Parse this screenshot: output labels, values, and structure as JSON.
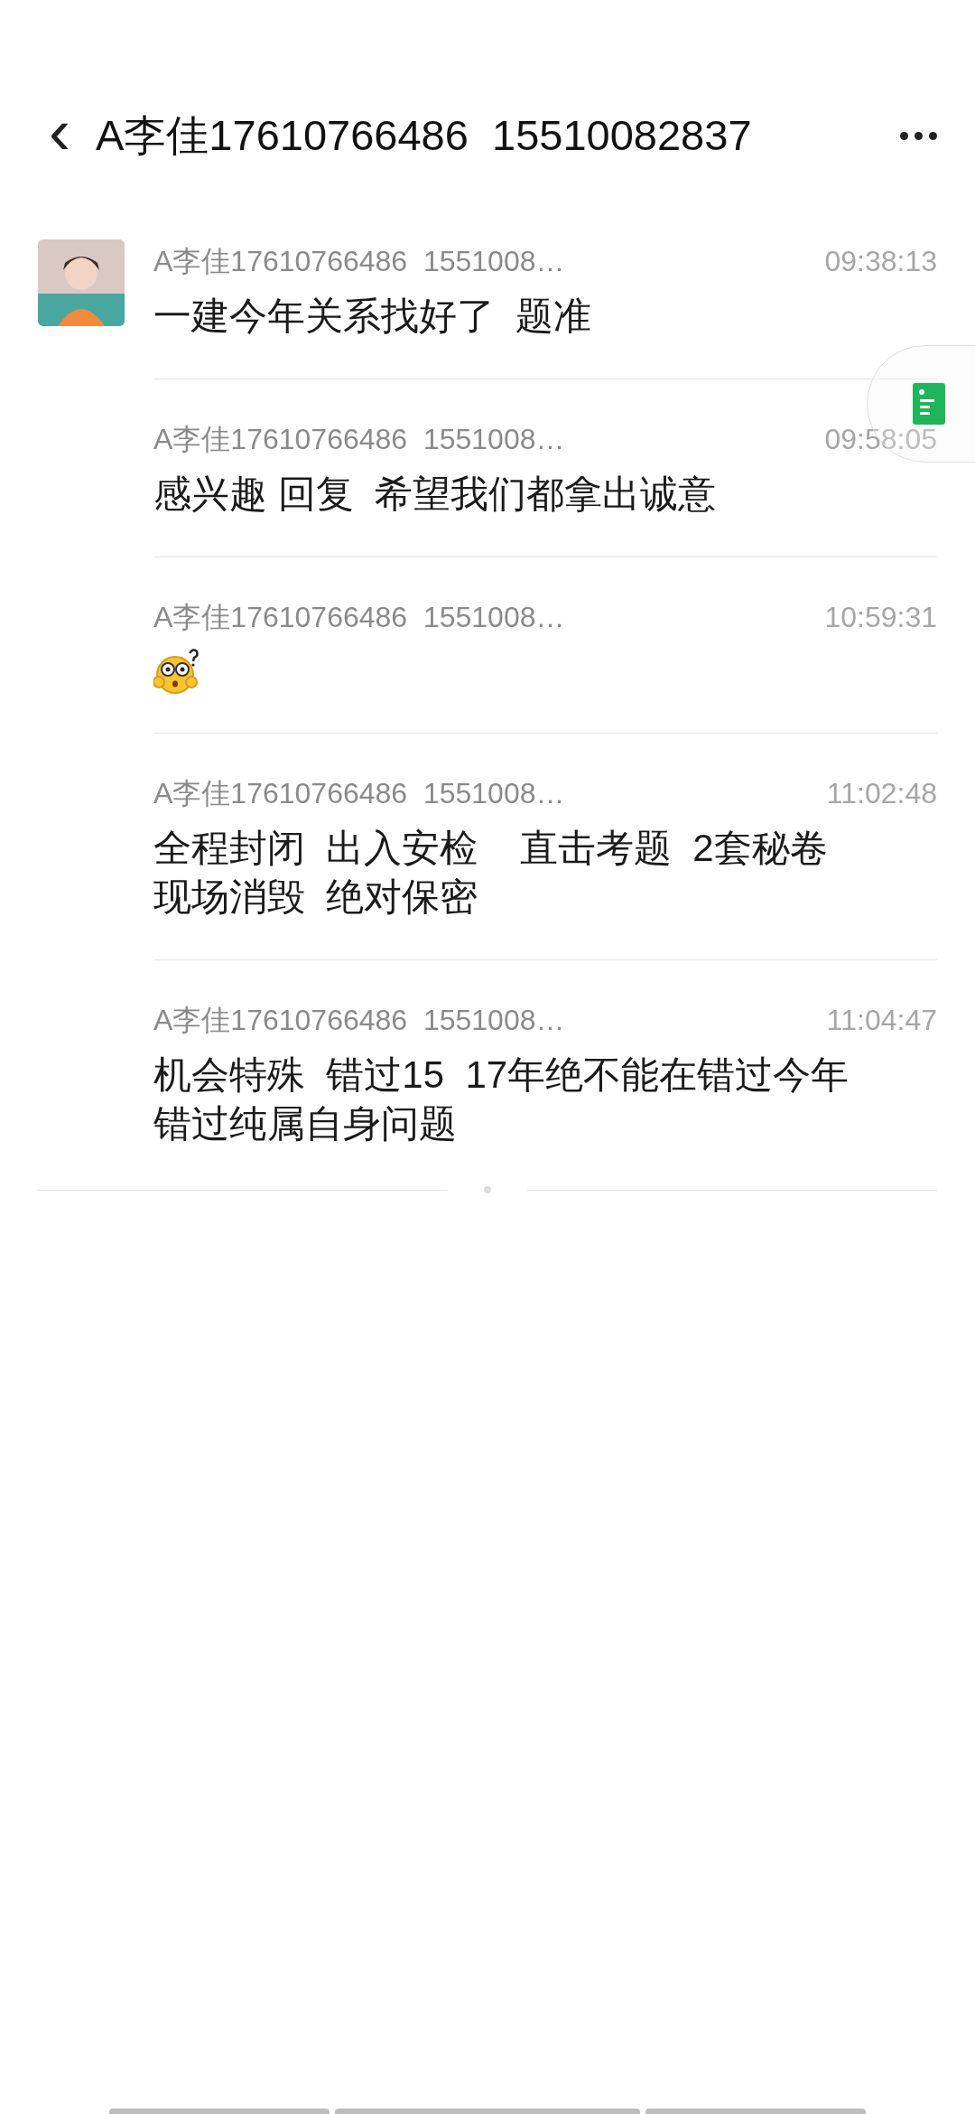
{
  "header": {
    "back": "‹",
    "title": "A李佳17610766486  15510082837"
  },
  "messages": [
    {
      "kind": "text",
      "avatar": true,
      "sender": "A李佳17610766486  1551008…",
      "time": "09:38:13",
      "lines": [
        "一建今年关系找好了  题准"
      ]
    },
    {
      "kind": "text",
      "avatar": false,
      "sender": "A李佳17610766486  1551008…",
      "time": "09:58:05",
      "lines": [
        "感兴趣 回复  希望我们都拿出诚意"
      ]
    },
    {
      "kind": "emoji",
      "avatar": false,
      "sender": "A李佳17610766486  1551008…",
      "time": "10:59:31"
    },
    {
      "kind": "text",
      "avatar": false,
      "sender": "A李佳17610766486  1551008…",
      "time": "11:02:48",
      "lines": [
        "全程封闭  出入安检    直击考题  2套秘卷",
        "现场消毁  绝对保密"
      ]
    },
    {
      "kind": "text",
      "avatar": false,
      "sender": "A李佳17610766486  1551008…",
      "time": "11:04:47",
      "lines": [
        "机会特殊  错过15  17年绝不能在错过今年",
        "错过纯属自身问题"
      ]
    }
  ]
}
